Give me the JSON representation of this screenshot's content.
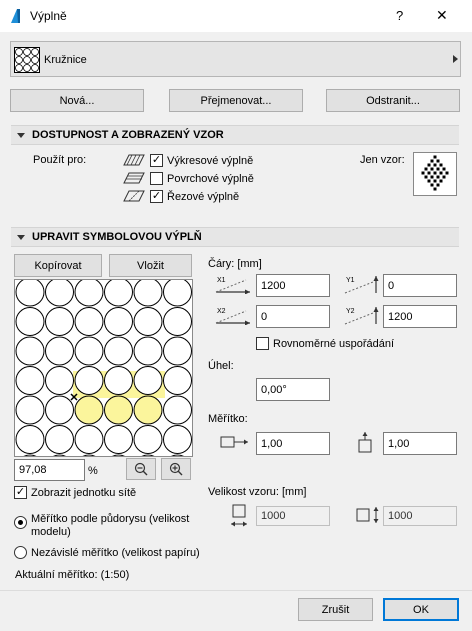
{
  "window": {
    "title": "Výplně",
    "help": "?",
    "close": "✕"
  },
  "selector": {
    "name": "Kružnice"
  },
  "top_buttons": {
    "new": "Nová...",
    "rename": "Přejmenovat...",
    "delete": "Odstranit..."
  },
  "availability": {
    "heading": "DOSTUPNOST A ZOBRAZENÝ VZOR",
    "use_for": "Použít pro:",
    "only_pattern": "Jen vzor:",
    "options": [
      {
        "label": "Výkresové výplně",
        "checked": true
      },
      {
        "label": "Povrchové výplně",
        "checked": false
      },
      {
        "label": "Řezové výplně",
        "checked": true
      }
    ]
  },
  "edit": {
    "heading": "UPRAVIT SYMBOLOVOU VÝPLŇ",
    "copy": "Kopírovat",
    "paste": "Vložit",
    "lines_label": "Čáry: [mm]",
    "x1": "1200",
    "y1": "0",
    "x2": "0",
    "y2": "1200",
    "x1_tag": "X1",
    "y1_tag": "Y1",
    "x2_tag": "X2",
    "y2_tag": "Y2",
    "uniform": "Rovnoměrné uspořádání",
    "uniform_checked": false,
    "angle_label": "Úhel:",
    "angle": "0,00°",
    "scale_label": "Měřítko:",
    "scale_x": "1,00",
    "scale_y": "1,00",
    "zoom": "97,08",
    "zoom_unit": "%",
    "show_grid_unit": "Zobrazit jednotku sítě",
    "show_grid_checked": true,
    "pattern_size_label": "Velikost vzoru: [mm]",
    "size_w": "1000",
    "size_h": "1000",
    "radio_model": "Měřítko podle půdorysu (velikost modelu)",
    "radio_paper": "Nezávislé měřítko (velikost papíru)",
    "current_scale": "Aktuální měřítko: (1:50)",
    "zoom_out_icon": "−",
    "zoom_in_icon": "+"
  },
  "footer": {
    "cancel": "Zrušit",
    "ok": "OK"
  }
}
